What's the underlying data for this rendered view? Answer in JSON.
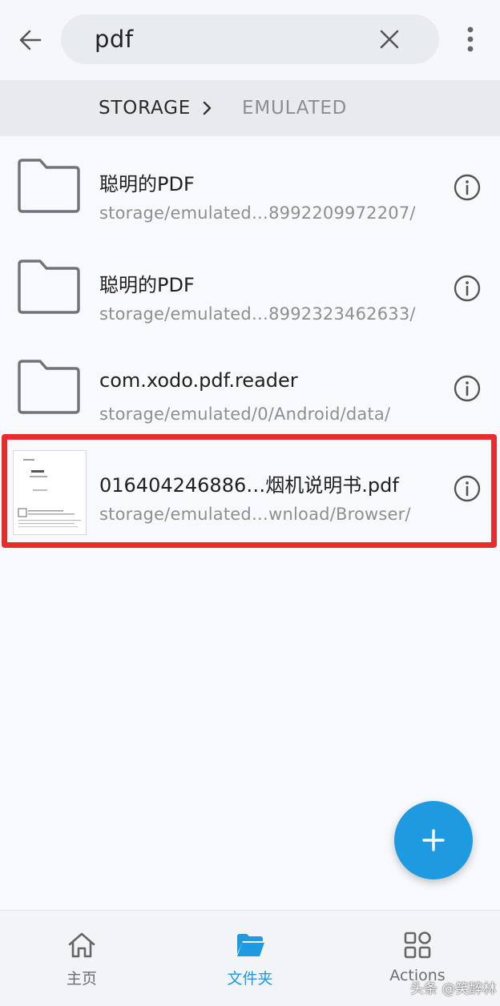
{
  "search": {
    "query": "pdf"
  },
  "breadcrumb": {
    "items": [
      "STORAGE",
      "EMULATED"
    ]
  },
  "files": [
    {
      "name": "聪明的PDF",
      "path": "storage/emulated…8992209972207/",
      "type": "folder"
    },
    {
      "name": "聪明的PDF",
      "path": "storage/emulated…8992323462633/",
      "type": "folder"
    },
    {
      "name": "com.xodo.pdf.reader",
      "path": "storage/emulated/0/Android/data/",
      "type": "folder"
    },
    {
      "name": "016404246886…烟机说明书.pdf",
      "path": "storage/emulated…wnload/Browser/",
      "type": "pdf",
      "highlighted": true
    }
  ],
  "bottom_nav": {
    "home": "主页",
    "folders": "文件夹",
    "actions": "Actions"
  },
  "watermark": "头条 @笑醉林",
  "colors": {
    "accent": "#1e9be0",
    "highlight": "#e52d2d"
  },
  "icons": [
    "back-arrow-icon",
    "close-icon",
    "more-vert-icon",
    "chevron-right-icon",
    "folder-icon",
    "info-icon",
    "plus-icon",
    "home-icon",
    "folder-open-icon",
    "grid-icon"
  ]
}
